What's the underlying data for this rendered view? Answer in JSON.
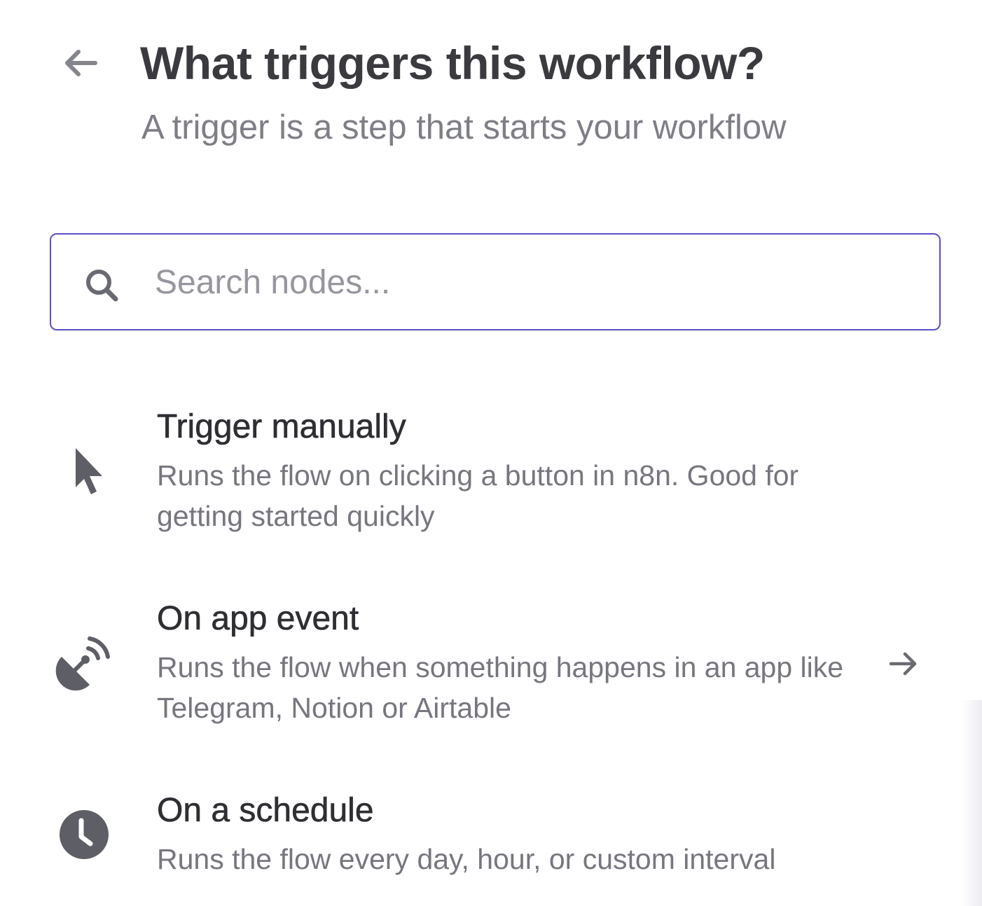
{
  "header": {
    "back_label": "Back",
    "title": "What triggers this workflow?",
    "subtitle": "A trigger is a step that starts your workflow"
  },
  "search": {
    "placeholder": "Search nodes...",
    "value": "",
    "icon": "search-icon"
  },
  "nodes": [
    {
      "icon": "cursor-pointer-icon",
      "title": "Trigger manually",
      "description": "Runs the flow on clicking a button in n8n. Good for getting started quickly",
      "has_submenu": false
    },
    {
      "icon": "satellite-dish-icon",
      "title": "On app event",
      "description": "Runs the flow when something happens in an app like Telegram, Notion or Airtable",
      "has_submenu": true,
      "submenu_icon": "arrow-right-icon"
    },
    {
      "icon": "clock-icon",
      "title": "On a schedule",
      "description": "Runs the flow every day, hour, or custom interval",
      "has_submenu": false
    }
  ],
  "colors": {
    "accent": "#5b4fc4",
    "title_text": "#3a3a3f",
    "muted_text": "#7e7e86",
    "icon_gray": "#5e5e66"
  }
}
